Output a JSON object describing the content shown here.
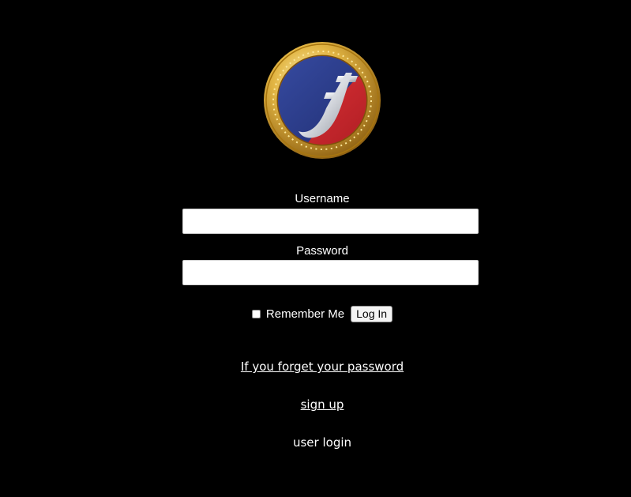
{
  "form": {
    "username_label": "Username",
    "username_value": "",
    "password_label": "Password",
    "password_value": "",
    "remember_label": "Remember Me",
    "login_button": "Log In"
  },
  "links": {
    "forgot_password": "If you forget your password",
    "sign_up": "sign up",
    "user_login": "user login"
  },
  "logo": {
    "icon": "coin-logo-icon",
    "colors": {
      "gold": "#d4a531",
      "blue": "#2d3f8e",
      "red": "#d8282d",
      "background": "#000000"
    }
  }
}
